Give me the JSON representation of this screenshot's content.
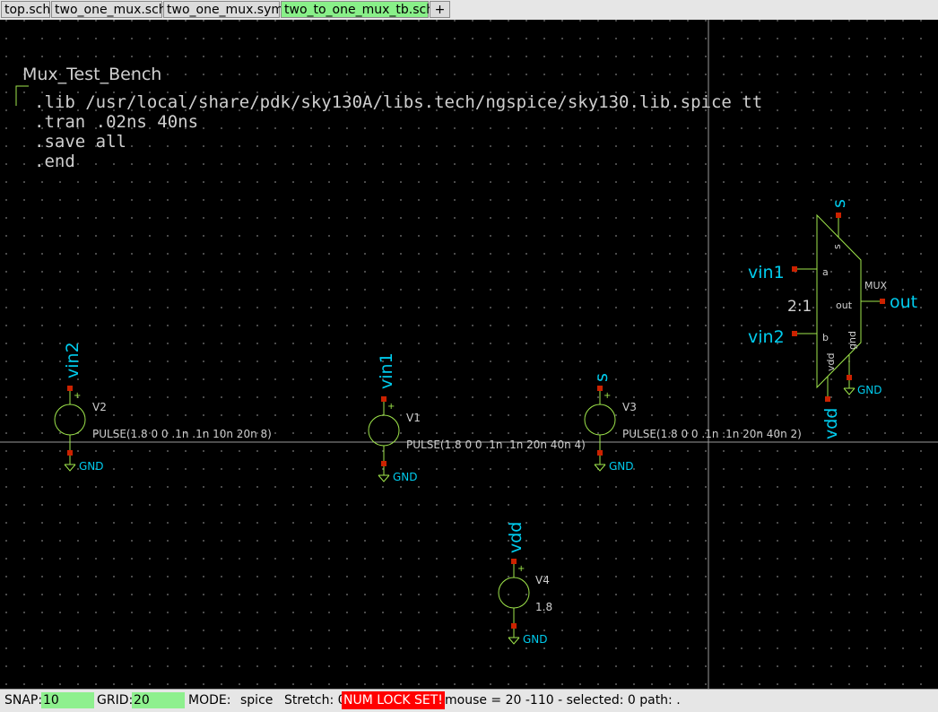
{
  "tabs": [
    {
      "label": "top.sch"
    },
    {
      "label": "two_one_mux.sch"
    },
    {
      "label": "two_one_mux.sym"
    },
    {
      "label": "two_to_one_mux_tb.sch"
    },
    {
      "label": "+"
    }
  ],
  "schematic": {
    "title": "Mux_Test_Bench",
    "code": [
      ".lib /usr/local/share/pdk/sky130A/libs.tech/ngspice/sky130.lib.spice tt",
      ".tran .02ns 40ns",
      ".save all",
      ".end"
    ],
    "sources": [
      {
        "name": "V2",
        "net": "vin2",
        "value": "PULSE(1.8 0 0 .1n .1n 10n 20n 8)",
        "gnd": "GND"
      },
      {
        "name": "V1",
        "net": "vin1",
        "value": "PULSE(1.8 0 0 .1n .1n 20n 40n 4)",
        "gnd": "GND"
      },
      {
        "name": "V3",
        "net": "s",
        "value": "PULSE(1.8 0 0 .1n .1n 20n 40n 2)",
        "gnd": "GND"
      },
      {
        "name": "V4",
        "net": "vdd",
        "value": "1.8",
        "gnd": "GND"
      }
    ],
    "mux": {
      "label": "MUX",
      "ratio": "2:1",
      "pins": {
        "a": "a",
        "b": "b",
        "s": "s",
        "out": "out",
        "vdd": "vdd",
        "gnd": "gnd"
      },
      "nets": {
        "a": "vin1",
        "b": "vin2",
        "s": "s",
        "out": "out",
        "vdd": "vdd",
        "gnd": "GND"
      }
    }
  },
  "status": {
    "snap_label": "SNAP:",
    "snap_value": "10",
    "grid_label": "GRID:",
    "grid_value": "20",
    "mode_label": "MODE:",
    "mode_value": "spice",
    "stretch_label": "Stretch: 0",
    "numlock": "NUM LOCK SET!",
    "mouse": "mouse = 20 -110 - selected: 0 path: ."
  },
  "colors": {
    "wire": "#9fe64b",
    "net": "#00ccee",
    "pin": "#cc2200",
    "text": "#cfcfcf",
    "grid": "#5c5c5c"
  }
}
